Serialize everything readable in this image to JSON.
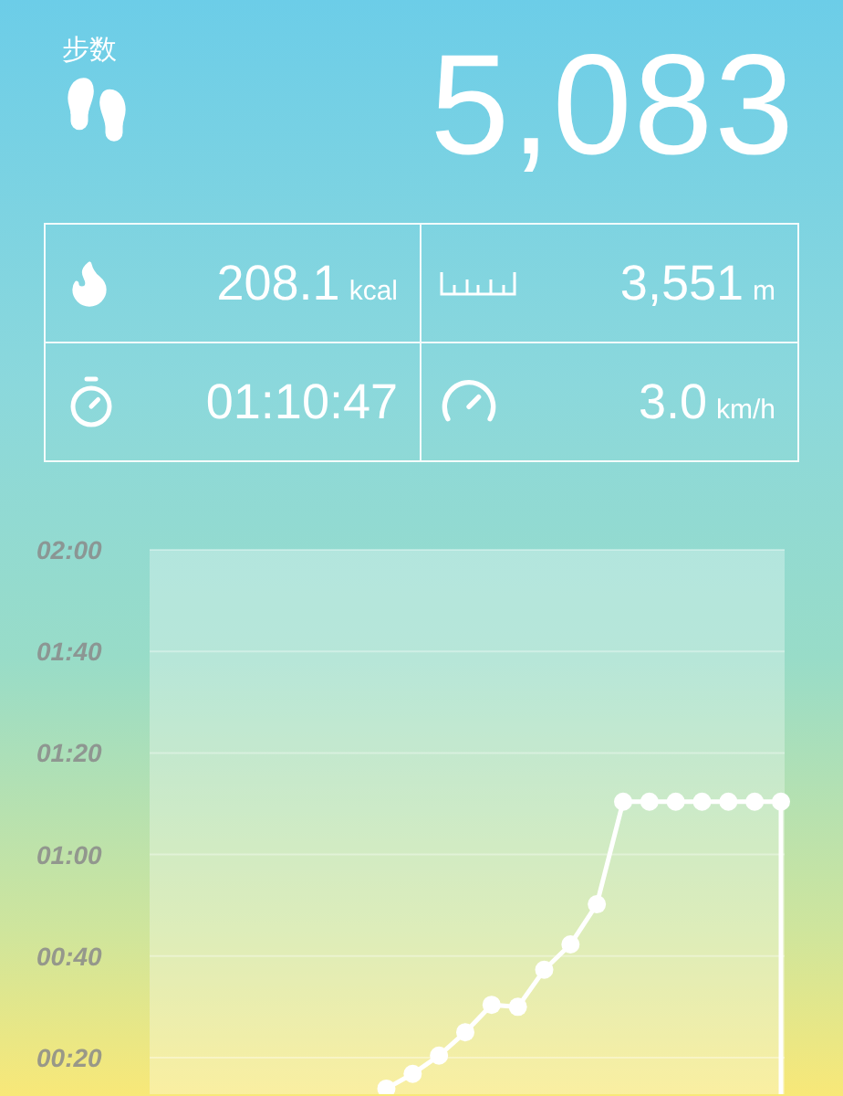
{
  "steps": {
    "label": "步数",
    "value": "5,083"
  },
  "stats": [
    {
      "kind": "calories",
      "value": "208.1",
      "unit": "kcal"
    },
    {
      "kind": "distance",
      "value": "3,551",
      "unit": "m"
    },
    {
      "kind": "duration",
      "value": "01:10:47"
    },
    {
      "kind": "speed",
      "value": "3.0",
      "unit": "km/h"
    }
  ],
  "chart": {
    "chart_data": {
      "type": "line",
      "ylim": [
        12.8,
        120
      ],
      "grid": true,
      "yticks": [
        {
          "value": 20,
          "label": "00:20"
        },
        {
          "value": 40,
          "label": "00:40"
        },
        {
          "value": 60,
          "label": "01:00"
        },
        {
          "value": 80,
          "label": "01:20"
        },
        {
          "value": 100,
          "label": "01:40"
        },
        {
          "value": 120,
          "label": "02:00"
        }
      ],
      "categories": [
        null,
        null,
        null,
        null,
        null,
        null,
        null,
        null,
        null,
        null,
        null,
        null,
        null,
        null,
        null,
        null,
        null,
        null,
        null,
        null,
        null,
        null,
        null,
        null,
        null
      ],
      "series": [
        {
          "color": "#ffffff",
          "marker": "circle",
          "values": [
            null,
            null,
            null,
            null,
            null,
            null,
            null,
            null,
            null,
            13.9,
            16.8,
            20.4,
            25,
            30.4,
            30,
            37.3,
            42.3,
            50.2,
            70.4,
            70.4,
            70.4,
            70.4,
            70.4,
            70.4,
            70.4
          ]
        }
      ]
    }
  }
}
